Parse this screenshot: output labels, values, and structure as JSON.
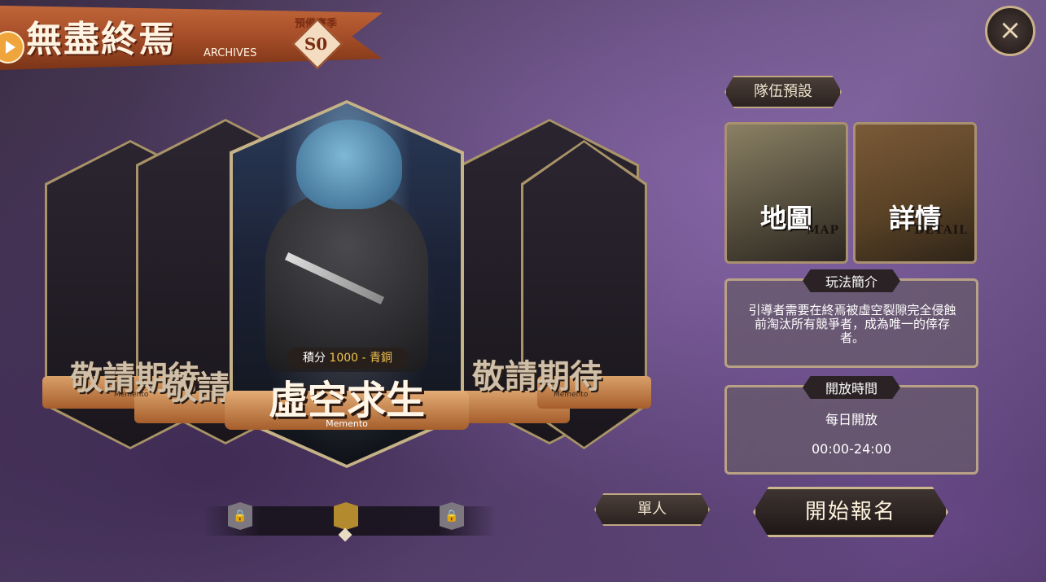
{
  "header": {
    "title": "無盡終焉",
    "subtitle": "ARCHIVES",
    "season_label": "預備賽季",
    "season_value": "S0"
  },
  "cards": {
    "coming_soon": "敬請期待",
    "memento_small": "Memento",
    "featured": {
      "score_label": "積分",
      "score_value": "1000 - 青銅",
      "title": "虛空求生",
      "subtitle": "Memento"
    }
  },
  "pager": {
    "total": 3,
    "active_index": 1
  },
  "right_panel": {
    "team_preset": "隊伍預設",
    "map_tile": {
      "title": "地圖",
      "sub": "MAP"
    },
    "detail_tile": {
      "title": "詳情",
      "sub": "DETAIL"
    },
    "intro": {
      "heading": "玩法簡介",
      "text": "引導者需要在終焉被虛空裂隙完全侵蝕前淘汰所有競爭者，成為唯一的倖存者。"
    },
    "open_time": {
      "heading": "開放時間",
      "days": "每日開放",
      "hours": "00:00-24:00"
    }
  },
  "actions": {
    "mode": "單人",
    "start": "開始報名"
  },
  "icons": {
    "close": "close-icon",
    "lock": "lock-icon",
    "play": "play-icon"
  },
  "colors": {
    "banner": "#a44c27",
    "accent_gold": "#f2c34c",
    "frame": "#bfa583"
  }
}
